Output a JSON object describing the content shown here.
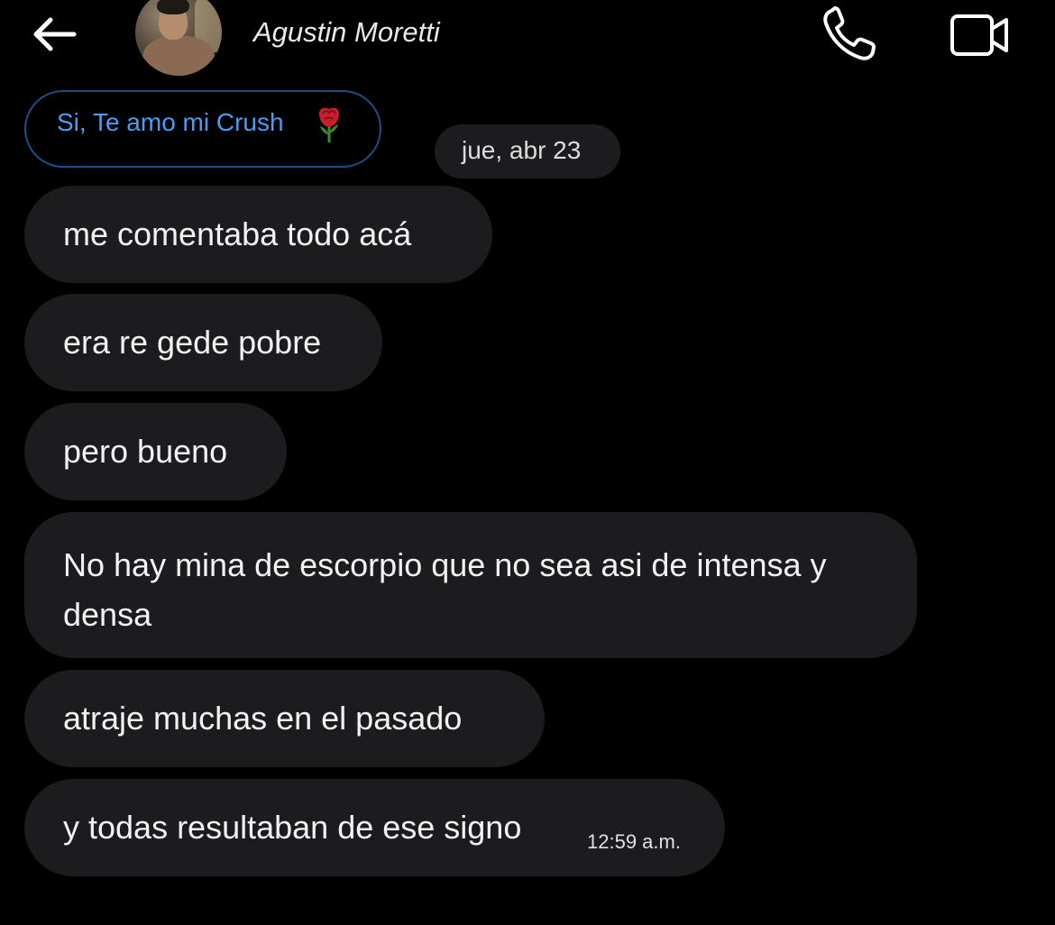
{
  "header": {
    "contact_name": "Agustin Moretti",
    "back_icon": "arrow-left-icon",
    "call_icon": "phone-icon",
    "video_icon": "video-camera-icon",
    "avatar": "contact-avatar-photo"
  },
  "reply_preview": {
    "text": "Si, Te amo mi Crush",
    "emoji_icon": "rose-icon",
    "border_color": "#1d4f86",
    "text_color": "#4a9df0"
  },
  "date_separator": "jue, abr 23",
  "messages": [
    {
      "text": "me comentaba todo acá"
    },
    {
      "text": "era re gede pobre"
    },
    {
      "text": "pero bueno"
    },
    {
      "text": "No hay mina de escorpio que no sea asi de intensa y densa"
    },
    {
      "text": "atraje muchas en el pasado"
    },
    {
      "text": "y todas resultaban de ese signo",
      "timestamp": "12:59 a.m."
    }
  ],
  "colors": {
    "background": "#000000",
    "bubble": "#1c1c1e",
    "text": "#f2f2f2"
  }
}
